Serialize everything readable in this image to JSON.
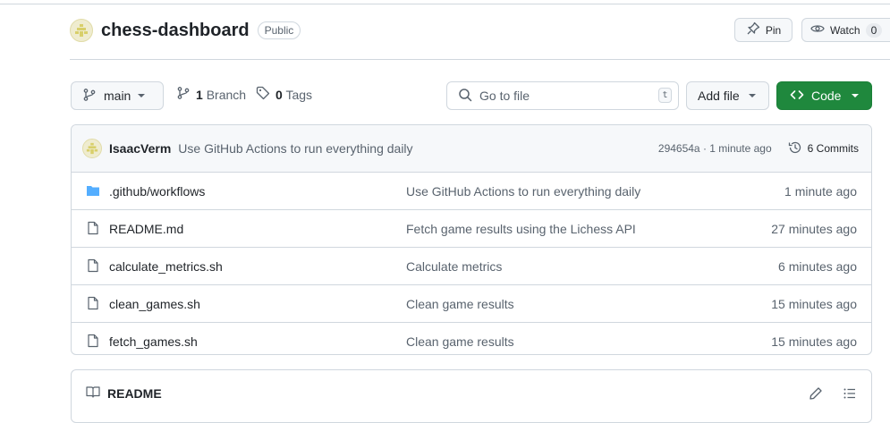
{
  "repo": {
    "name": "chess-dashboard",
    "visibility": "Public",
    "pin_label": "Pin",
    "watch_label": "Watch",
    "watch_count": "0"
  },
  "toolbar": {
    "branch": "main",
    "branch_count": "1",
    "branch_label": "Branch",
    "tag_count": "0",
    "tag_label": "Tags",
    "search_placeholder": "Go to file",
    "search_shortcut": "t",
    "add_file_label": "Add file",
    "code_label": "Code"
  },
  "latest_commit": {
    "author": "IsaacVerm",
    "message": "Use GitHub Actions to run everything daily",
    "sha_time": "294654a · 1 minute ago",
    "commits_label": "6 Commits"
  },
  "files": [
    {
      "name": ".github/workflows",
      "type": "folder",
      "message": "Use GitHub Actions to run everything daily",
      "time": "1 minute ago"
    },
    {
      "name": "README.md",
      "type": "file",
      "message": "Fetch game results using the Lichess API",
      "time": "27 minutes ago"
    },
    {
      "name": "calculate_metrics.sh",
      "type": "file",
      "message": "Calculate metrics",
      "time": "6 minutes ago"
    },
    {
      "name": "clean_games.sh",
      "type": "file",
      "message": "Clean game results",
      "time": "15 minutes ago"
    },
    {
      "name": "fetch_games.sh",
      "type": "file",
      "message": "Clean game results",
      "time": "15 minutes ago"
    }
  ],
  "readme": {
    "title": "README"
  },
  "colors": {
    "accent_green": "#1f883d",
    "folder_blue": "#54aeff",
    "border": "#d0d7de"
  },
  "icons": [
    "repo-avatar-icon",
    "pin-icon",
    "eye-icon",
    "branch-icon",
    "tag-icon",
    "search-icon",
    "code-icon",
    "history-icon",
    "folder-icon",
    "file-icon",
    "book-icon",
    "pencil-icon",
    "list-icon"
  ]
}
